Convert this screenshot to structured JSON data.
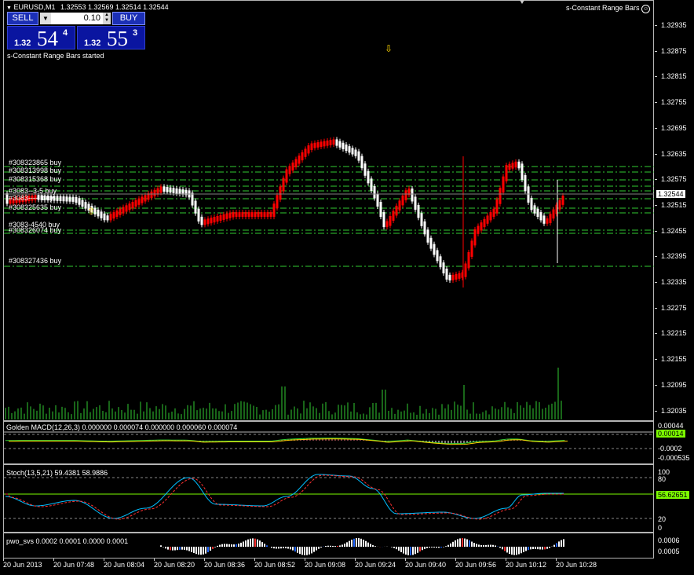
{
  "header": {
    "symbol_label": "EURUSD,M1",
    "ohlc": "1.32553 1.32569 1.32514 1.32544",
    "indicator_name": "s-Constant Range Bars",
    "indicator_icon": "smiley-icon",
    "started_msg": "s-Constant Range Bars started"
  },
  "trade_panel": {
    "sell_label": "SELL",
    "buy_label": "BUY",
    "lot": "0.10",
    "sell_prefix": "1.32",
    "sell_big": "54",
    "sell_sup": "4",
    "buy_prefix": "1.32",
    "buy_big": "55",
    "buy_sup": "3"
  },
  "price_axis": [
    "1.32935",
    "1.32875",
    "1.32815",
    "1.32755",
    "1.32695",
    "1.32635",
    "1.32575",
    "1.32515",
    "1.32455",
    "1.32395",
    "1.32335",
    "1.32275",
    "1.32215",
    "1.32155",
    "1.32095",
    "1.32035"
  ],
  "current_price": "1.32544",
  "orders": [
    "#308323865 buy",
    "#308313998 buy",
    "#308315368 buy",
    "#308325635 buy",
    "#308326074 buy",
    "#308327436 buy"
  ],
  "order_overlap": [
    "#3083--3-5 buy",
    "#3083----- buy",
    "#3083-4540 buy"
  ],
  "macd": {
    "title": "Golden MACD(12,26,3) 0.000000 0.000074 0.000000 0.000060 0.000074",
    "levels": [
      "0.00044",
      "0.00014",
      "-0.0002",
      "-0.000535"
    ],
    "current": "0.00014"
  },
  "stoch": {
    "title": "Stoch(13,5,21) 59.4381 58.9886",
    "levels": [
      "100",
      "80",
      "20",
      "0"
    ],
    "current": "56.62651"
  },
  "pwo": {
    "title": "pwo_svs 0.0002 0.0001 0.0000 0.0001",
    "levels": [
      "0.0006",
      "0.0005"
    ]
  },
  "time_axis": [
    "20 Jun 2013",
    "20 Jun 07:48",
    "20 Jun 08:04",
    "20 Jun 08:20",
    "20 Jun 08:36",
    "20 Jun 08:52",
    "20 Jun 09:08",
    "20 Jun 09:24",
    "20 Jun 09:40",
    "20 Jun 09:56",
    "20 Jun 10:12",
    "20 Jun 10:28"
  ],
  "colors": {
    "bull": "#ff0000",
    "bear": "#ffffff",
    "order_line": "#32cd32",
    "volume": "#32cd32",
    "macd_signal": "#ffd700",
    "stoch_main": "#00bfff",
    "stoch_signal": "#ff3030",
    "brand_blue": "#1b2fb5"
  }
}
